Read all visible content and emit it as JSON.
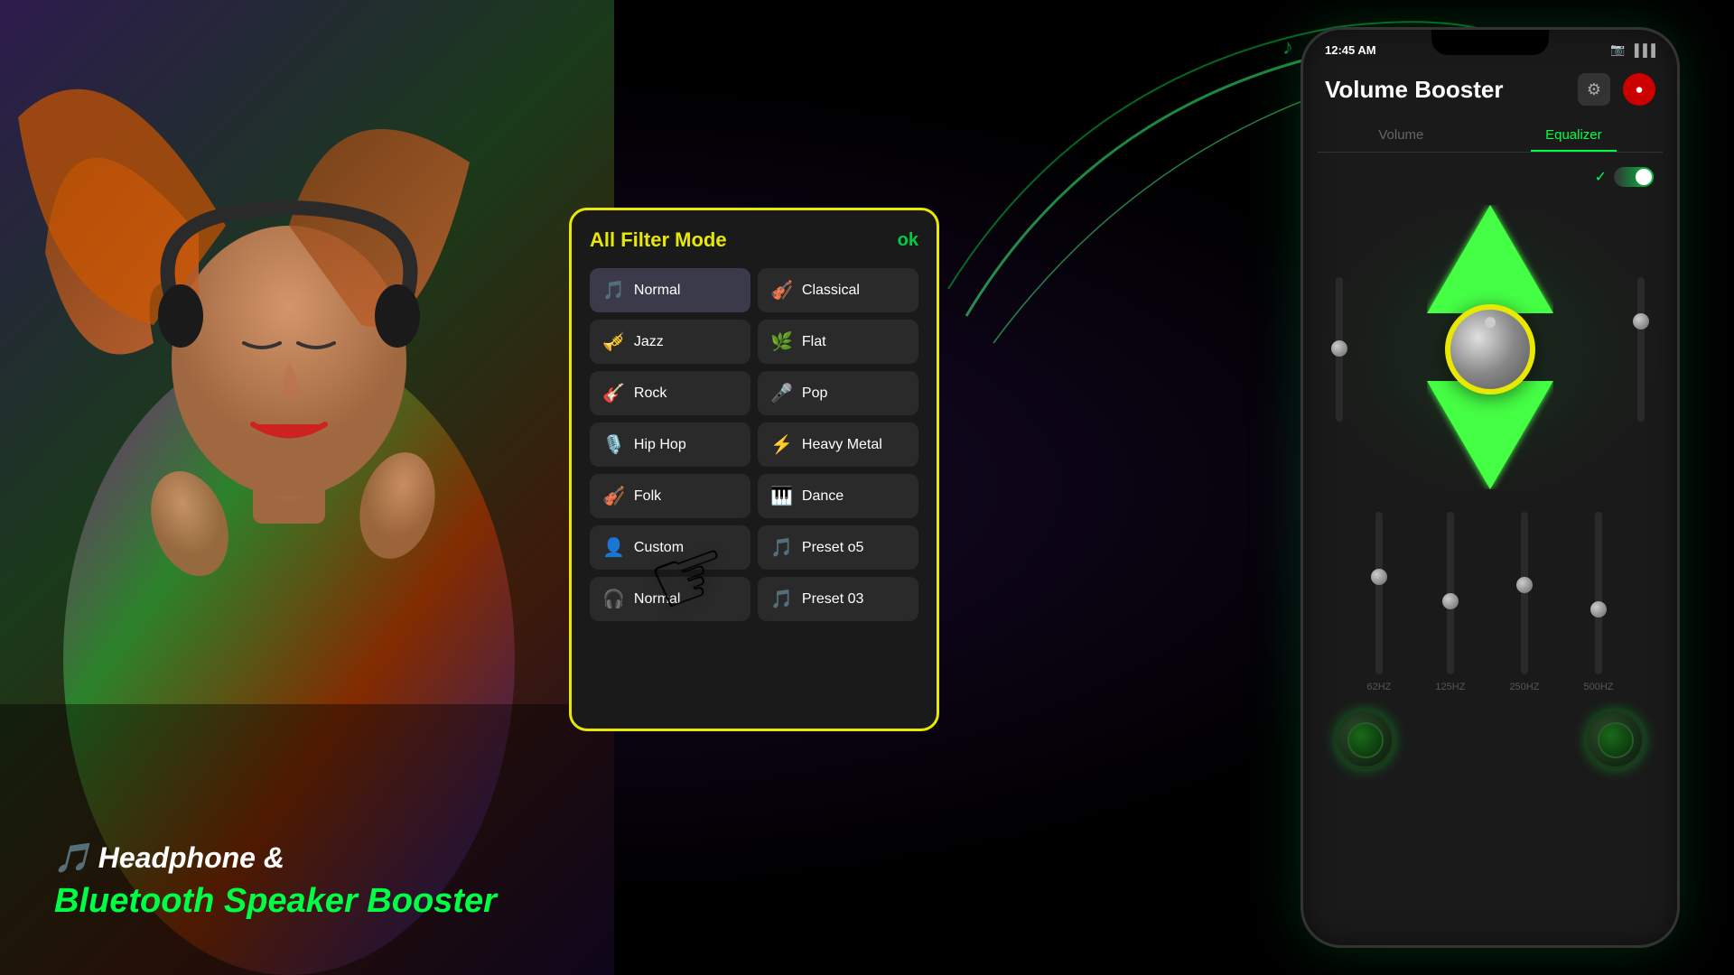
{
  "background": {
    "color": "#000000"
  },
  "bottom_left": {
    "line1": "🎵 Headphone &",
    "line2": "Bluetooth Speaker Booster"
  },
  "filter_modal": {
    "title": "All Filter Mode",
    "ok_label": "ok",
    "items": [
      {
        "id": "normal",
        "label": "Normal",
        "icon": "🎵",
        "icon_color": "#9b59b6",
        "col": 0
      },
      {
        "id": "classical",
        "label": "Classical",
        "icon": "🎻",
        "icon_color": "#9b59b6",
        "col": 1
      },
      {
        "id": "jazz",
        "label": "Jazz",
        "icon": "🎺",
        "icon_color": "#e67e22",
        "col": 0
      },
      {
        "id": "flat",
        "label": "Flat",
        "icon": "🌿",
        "icon_color": "#2ecc71",
        "col": 1
      },
      {
        "id": "rock",
        "label": "Rock",
        "icon": "🎸",
        "icon_color": "#3498db",
        "col": 0
      },
      {
        "id": "pop",
        "label": "Pop",
        "icon": "🎤",
        "icon_color": "#e74c3c",
        "col": 1
      },
      {
        "id": "hiphop",
        "label": "Hip Hop",
        "icon": "🎙️",
        "icon_color": "#00bcd4",
        "col": 0
      },
      {
        "id": "heavymetal",
        "label": "Heavy Metal",
        "icon": "⚡",
        "icon_color": "#f1c40f",
        "col": 1
      },
      {
        "id": "folk",
        "label": "Folk",
        "icon": "🎻",
        "icon_color": "#e74c3c",
        "col": 0
      },
      {
        "id": "dance",
        "label": "Dance",
        "icon": "🎹",
        "icon_color": "#f39c12",
        "col": 1
      },
      {
        "id": "custom",
        "label": "Custom",
        "icon": "👤",
        "icon_color": "#f1c40f",
        "col": 0
      },
      {
        "id": "preset05",
        "label": "Preset o5",
        "icon": "🎵",
        "icon_color": "#2ecc71",
        "col": 1
      },
      {
        "id": "normal2",
        "label": "Normal",
        "icon": "🎧",
        "icon_color": "#aaa",
        "col": 0
      },
      {
        "id": "preset03",
        "label": "Preset 03",
        "icon": "🎵",
        "icon_color": "#aaa",
        "col": 1
      }
    ]
  },
  "phone": {
    "status_bar": {
      "time": "12:45 AM",
      "signal_icon": "📶"
    },
    "app_title": "Volume Booster",
    "tabs": [
      {
        "label": "Volume",
        "active": false
      },
      {
        "label": "Equalizer",
        "active": true
      }
    ],
    "equalizer": {
      "toggle_on": true,
      "hz_labels": [
        "62HZ",
        "125HZ",
        "250HZ",
        "500HZ"
      ]
    }
  },
  "icons": {
    "gear": "⚙",
    "record": "⏺",
    "camera": "📷",
    "signal": "▐▐▐",
    "checkmark": "✓"
  }
}
